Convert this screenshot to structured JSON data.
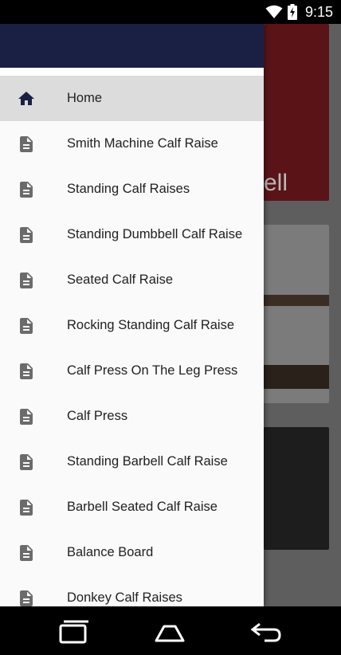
{
  "status_bar": {
    "time": "9:15"
  },
  "background": {
    "partial_text": "ell"
  },
  "drawer": {
    "items": [
      {
        "label": "Home",
        "icon": "home-icon",
        "selected": true
      },
      {
        "label": "Smith Machine Calf Raise",
        "icon": "document-icon"
      },
      {
        "label": "Standing Calf Raises",
        "icon": "document-icon"
      },
      {
        "label": "Standing Dumbbell Calf Raise",
        "icon": "document-icon"
      },
      {
        "label": "Seated Calf Raise",
        "icon": "document-icon"
      },
      {
        "label": "Rocking Standing Calf Raise",
        "icon": "document-icon"
      },
      {
        "label": "Calf Press On The Leg Press",
        "icon": "document-icon"
      },
      {
        "label": "Calf Press",
        "icon": "document-icon"
      },
      {
        "label": "Standing Barbell Calf Raise",
        "icon": "document-icon"
      },
      {
        "label": "Barbell Seated Calf Raise",
        "icon": "document-icon"
      },
      {
        "label": "Balance Board",
        "icon": "document-icon"
      },
      {
        "label": "Donkey Calf Raises",
        "icon": "document-icon"
      }
    ]
  },
  "colors": {
    "header": "#1a2043",
    "selected_row": "#dcdcdc",
    "icon": "#6b6b6b",
    "home_icon": "#1a2043"
  }
}
